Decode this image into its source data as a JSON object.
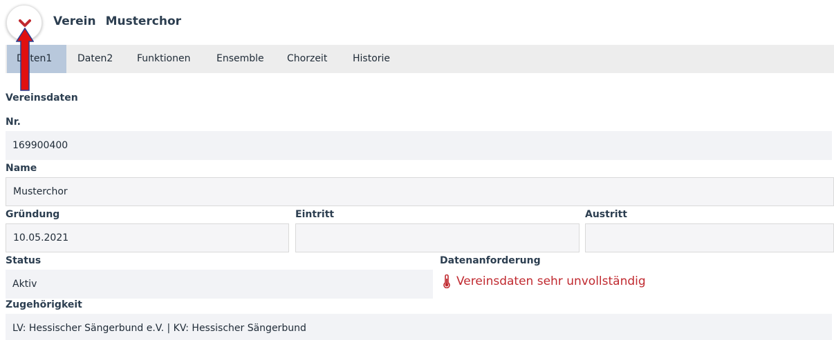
{
  "header": {
    "entity": "Verein",
    "name": "Musterchor"
  },
  "tabs": [
    {
      "label": "Daten1",
      "active": true
    },
    {
      "label": "Daten2",
      "active": false
    },
    {
      "label": "Funktionen",
      "active": false
    },
    {
      "label": "Ensemble",
      "active": false
    },
    {
      "label": "Chorzeit",
      "active": false
    },
    {
      "label": "Historie",
      "active": false
    }
  ],
  "section": {
    "title": "Vereinsdaten"
  },
  "fields": {
    "nr": {
      "label": "Nr.",
      "value": "169900400"
    },
    "name": {
      "label": "Name",
      "value": "Musterchor"
    },
    "gruendung": {
      "label": "Gründung",
      "value": "10.05.2021"
    },
    "eintritt": {
      "label": "Eintritt",
      "value": ""
    },
    "austritt": {
      "label": "Austritt",
      "value": ""
    },
    "status": {
      "label": "Status",
      "value": "Aktiv"
    },
    "datenanforderung": {
      "label": "Datenanforderung",
      "value": "Vereinsdaten sehr unvollständig"
    },
    "zugehoerigkeit": {
      "label": "Zugehörigkeit",
      "value": "LV: Hessischer Sängerbund e.V. | KV: Hessischer Sängerbund"
    }
  },
  "icons": {
    "collapse": "chevron-down-icon",
    "warning": "thermometer-icon",
    "annotation": "red-arrow-up"
  },
  "colors": {
    "accent_red": "#c0292f",
    "active_tab": "#b8c8dc",
    "tab_bar": "#ededed",
    "field_bg": "#f2f3f6"
  }
}
